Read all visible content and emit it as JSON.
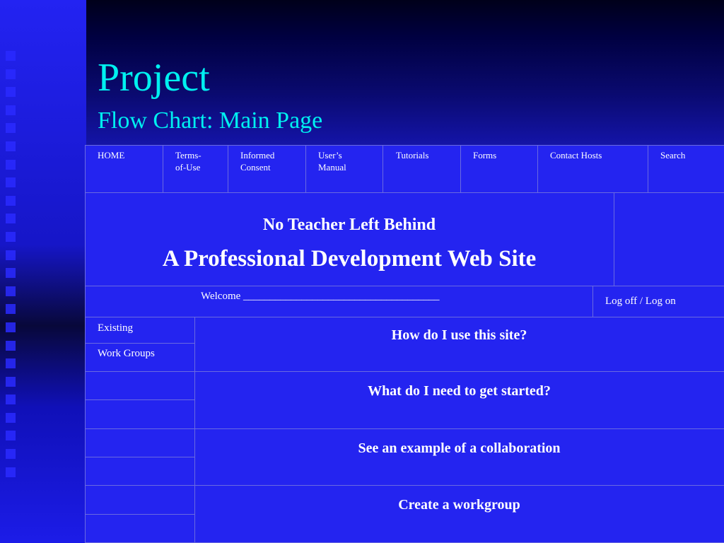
{
  "slide": {
    "title": "Project",
    "subtitle": "Flow Chart: Main Page"
  },
  "nav": {
    "items": [
      {
        "line1": "HOME",
        "line2": ""
      },
      {
        "line1": "Terms-",
        "line2": "of-Use"
      },
      {
        "line1": "Informed",
        "line2": "Consent"
      },
      {
        "line1": "User’s",
        "line2": "Manual"
      },
      {
        "line1": "Tutorials",
        "line2": ""
      },
      {
        "line1": "Forms",
        "line2": ""
      },
      {
        "line1": "Contact Hosts",
        "line2": ""
      },
      {
        "line1": "Search",
        "line2": ""
      }
    ]
  },
  "banner": {
    "tagline": "No Teacher Left Behind",
    "site_title": "A Professional Development Web Site"
  },
  "welcome": {
    "text": "Welcome _____________________________________",
    "auth_link": "Log off / Log on"
  },
  "sidebar": {
    "items": [
      "Existing",
      "Work Groups"
    ]
  },
  "main": {
    "questions": [
      "How do I use this site?",
      "What do I need to get started?",
      "See an example of a collaboration",
      "Create a workgroup"
    ]
  },
  "colors": {
    "title": "#00f0f0",
    "content_bg": "#2424f0",
    "grid_line": "#6a6ae0",
    "text": "#ffffff"
  }
}
